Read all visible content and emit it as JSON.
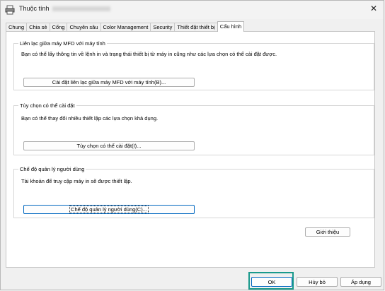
{
  "window": {
    "title": "Thuộc tính",
    "close_symbol": "✕",
    "icons": {
      "app": "printer-icon",
      "close": "close-icon"
    }
  },
  "tabs": [
    {
      "label": "Chung",
      "active": false
    },
    {
      "label": "Chia sẻ",
      "active": false
    },
    {
      "label": "Cổng",
      "active": false
    },
    {
      "label": "Chuyên sâu",
      "active": false
    },
    {
      "label": "Color Management",
      "active": false
    },
    {
      "label": "Security",
      "active": false
    },
    {
      "label": "Thiết đặt thiết bị",
      "active": false
    },
    {
      "label": "Cấu hình",
      "active": true
    }
  ],
  "groups": {
    "mfd_link": {
      "title": "Liên lạc giữa máy MFD với máy tính",
      "description": "Bạn có thể lấy thông tin về lệnh in và trạng thái thiết bị từ máy in cũng như các lựa chọn có thể cài đặt được.",
      "button": "Cài đặt liên lạc giữa máy MFD với máy tính(B)..."
    },
    "options": {
      "title": "Tùy chọn có thể cài đặt",
      "description": "Bạn có thể thay đổi nhiều thiết lập các lựa chọn khả dụng.",
      "button": "Tùy chọn có thể cài đặt(I)..."
    },
    "user_mgmt": {
      "title": "Chế độ quản lý người dùng",
      "description": "Tài khoản để truy cập máy in sẽ được thiết lập.",
      "button": "Chế độ quản lý người dùng(C)..."
    }
  },
  "about_button": "Giới thiệu",
  "footer": {
    "ok": "OK",
    "cancel": "Hủy bỏ",
    "apply": "Áp dụng"
  },
  "colors": {
    "focus_blue": "#0067c0",
    "highlight_teal": "#1a9a8c"
  }
}
